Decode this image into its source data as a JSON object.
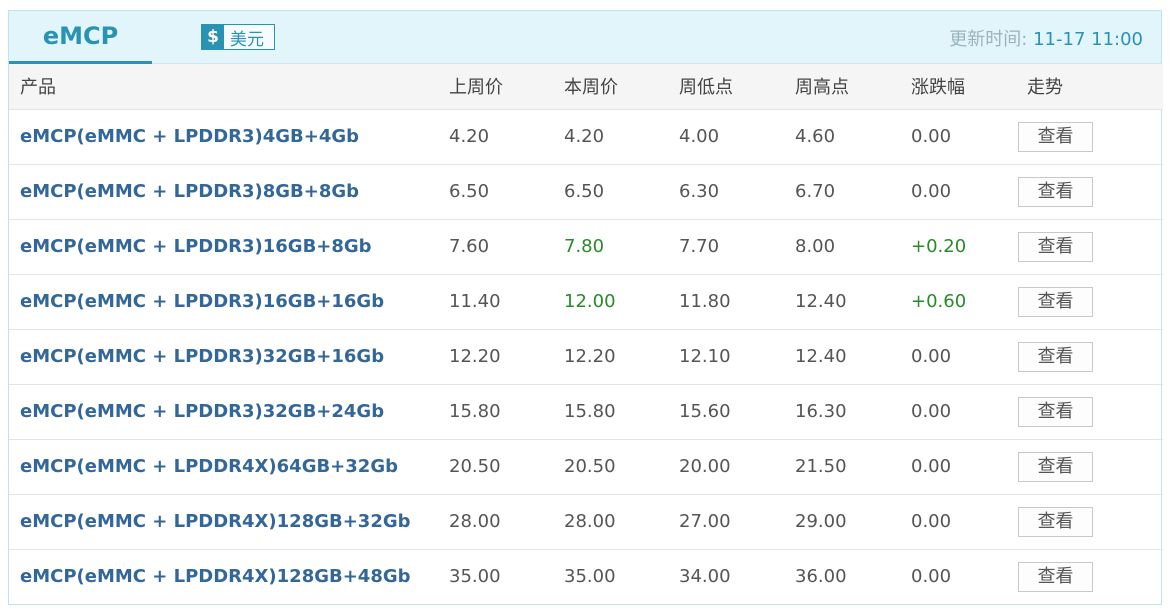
{
  "header": {
    "tab": "eMCP",
    "currency_symbol": "$",
    "currency_label": "美元",
    "update_label": "更新时间: ",
    "update_time": "11-17 11:00"
  },
  "columns": [
    "产品",
    "上周价",
    "本周价",
    "周低点",
    "周高点",
    "涨跌幅",
    "走势"
  ],
  "view_label": "查看",
  "colors": {
    "accent": "#2a93b4",
    "up": "#2a8a2a",
    "product": "#336699"
  },
  "rows": [
    {
      "product": "eMCP(eMMC + LPDDR3)4GB+4Gb",
      "last": "4.20",
      "this": "4.20",
      "low": "4.00",
      "high": "4.60",
      "change": "0.00",
      "up": false
    },
    {
      "product": "eMCP(eMMC + LPDDR3)8GB+8Gb",
      "last": "6.50",
      "this": "6.50",
      "low": "6.30",
      "high": "6.70",
      "change": "0.00",
      "up": false
    },
    {
      "product": "eMCP(eMMC + LPDDR3)16GB+8Gb",
      "last": "7.60",
      "this": "7.80",
      "low": "7.70",
      "high": "8.00",
      "change": "+0.20",
      "up": true
    },
    {
      "product": "eMCP(eMMC + LPDDR3)16GB+16Gb",
      "last": "11.40",
      "this": "12.00",
      "low": "11.80",
      "high": "12.40",
      "change": "+0.60",
      "up": true
    },
    {
      "product": "eMCP(eMMC + LPDDR3)32GB+16Gb",
      "last": "12.20",
      "this": "12.20",
      "low": "12.10",
      "high": "12.40",
      "change": "0.00",
      "up": false
    },
    {
      "product": "eMCP(eMMC + LPDDR3)32GB+24Gb",
      "last": "15.80",
      "this": "15.80",
      "low": "15.60",
      "high": "16.30",
      "change": "0.00",
      "up": false
    },
    {
      "product": "eMCP(eMMC + LPDDR4X)64GB+32Gb",
      "last": "20.50",
      "this": "20.50",
      "low": "20.00",
      "high": "21.50",
      "change": "0.00",
      "up": false
    },
    {
      "product": "eMCP(eMMC + LPDDR4X)128GB+32Gb",
      "last": "28.00",
      "this": "28.00",
      "low": "27.00",
      "high": "29.00",
      "change": "0.00",
      "up": false
    },
    {
      "product": "eMCP(eMMC + LPDDR4X)128GB+48Gb",
      "last": "35.00",
      "this": "35.00",
      "low": "34.00",
      "high": "36.00",
      "change": "0.00",
      "up": false
    }
  ]
}
